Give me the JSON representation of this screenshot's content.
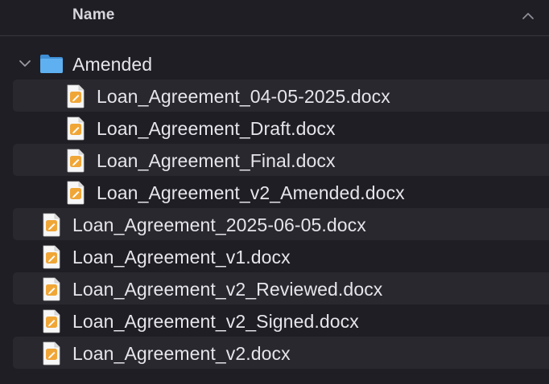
{
  "header": {
    "column_name": "Name",
    "sort_icon": "chevron-up-icon"
  },
  "colors": {
    "background": "#1f1e25",
    "stripe": "#29282f",
    "text": "#e6e5ea",
    "folder_blue": "#5aa9ea",
    "doc_accent": "#f0a637"
  },
  "folder": {
    "name": "Amended",
    "expanded": true,
    "icon": "folder-icon",
    "children": [
      {
        "name": "Loan_Agreement_04-05-2025.docx",
        "icon": "docx-file-icon"
      },
      {
        "name": "Loan_Agreement_Draft.docx",
        "icon": "docx-file-icon"
      },
      {
        "name": "Loan_Agreement_Final.docx",
        "icon": "docx-file-icon"
      },
      {
        "name": "Loan_Agreement_v2_Amended.docx",
        "icon": "docx-file-icon"
      }
    ]
  },
  "files": [
    {
      "name": "Loan_Agreement_2025-06-05.docx",
      "icon": "docx-file-icon"
    },
    {
      "name": "Loan_Agreement_v1.docx",
      "icon": "docx-file-icon"
    },
    {
      "name": "Loan_Agreement_v2_Reviewed.docx",
      "icon": "docx-file-icon"
    },
    {
      "name": "Loan_Agreement_v2_Signed.docx",
      "icon": "docx-file-icon"
    },
    {
      "name": "Loan_Agreement_v2.docx",
      "icon": "docx-file-icon"
    }
  ]
}
